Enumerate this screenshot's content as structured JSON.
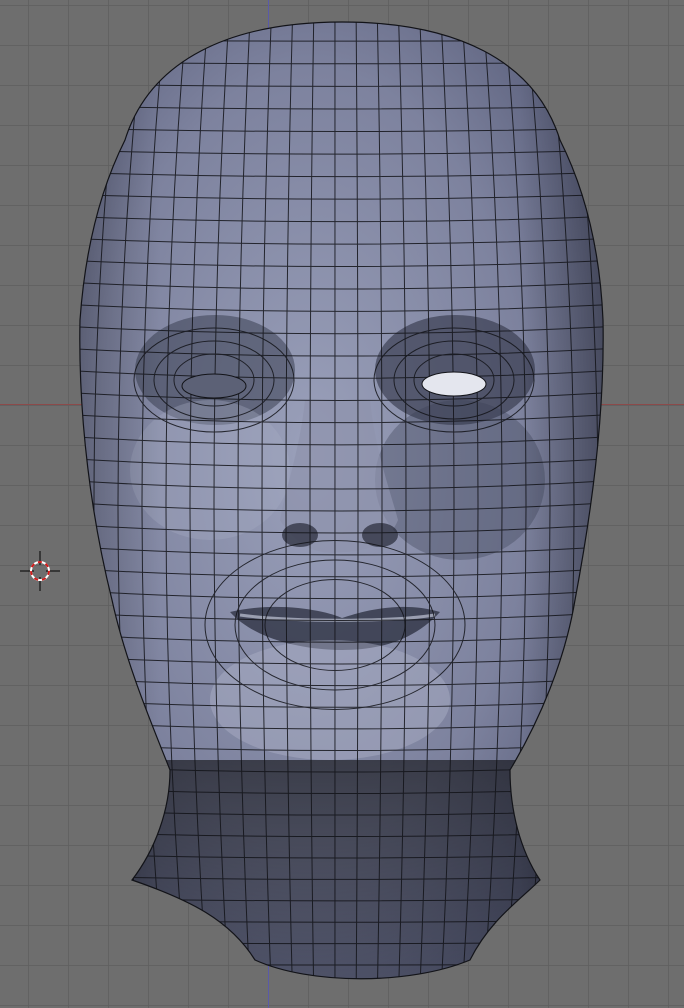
{
  "viewport": {
    "name": "3D Viewport",
    "background_color": "#6e6e6e",
    "grid_color": "#606060",
    "x_axis_color": "#8c4a4a",
    "y_axis_color": "#5a5aa8"
  },
  "mesh": {
    "name": "head-mesh",
    "display": "solid-wireframe",
    "face_color": "#7d829e",
    "edge_color": "#111111"
  },
  "cursor": {
    "icon": "3d-cursor-icon",
    "ring_color_a": "#ffffff",
    "ring_color_b": "#d11a1a"
  }
}
